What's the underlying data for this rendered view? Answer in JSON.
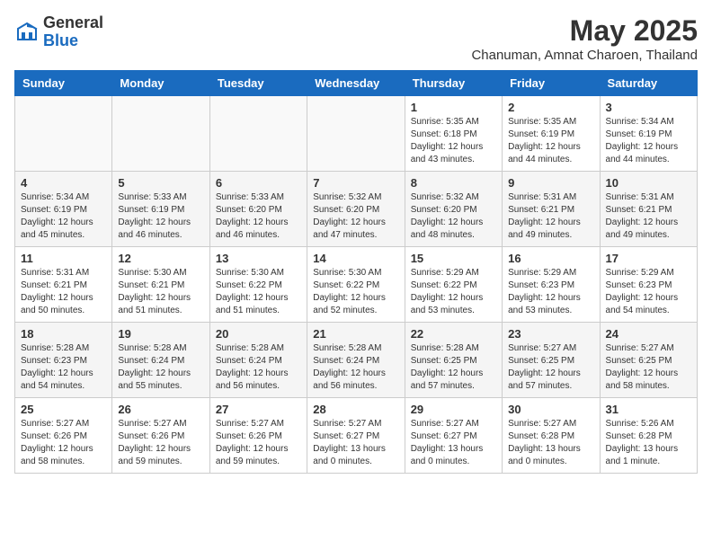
{
  "logo": {
    "general": "General",
    "blue": "Blue"
  },
  "title": "May 2025",
  "location": "Chanuman, Amnat Charoen, Thailand",
  "days_of_week": [
    "Sunday",
    "Monday",
    "Tuesday",
    "Wednesday",
    "Thursday",
    "Friday",
    "Saturday"
  ],
  "weeks": [
    [
      {
        "day": "",
        "sunrise": "",
        "sunset": "",
        "daylight": "",
        "empty": true
      },
      {
        "day": "",
        "sunrise": "",
        "sunset": "",
        "daylight": "",
        "empty": true
      },
      {
        "day": "",
        "sunrise": "",
        "sunset": "",
        "daylight": "",
        "empty": true
      },
      {
        "day": "",
        "sunrise": "",
        "sunset": "",
        "daylight": "",
        "empty": true
      },
      {
        "day": "1",
        "sunrise": "Sunrise: 5:35 AM",
        "sunset": "Sunset: 6:18 PM",
        "daylight": "Daylight: 12 hours and 43 minutes.",
        "empty": false
      },
      {
        "day": "2",
        "sunrise": "Sunrise: 5:35 AM",
        "sunset": "Sunset: 6:19 PM",
        "daylight": "Daylight: 12 hours and 44 minutes.",
        "empty": false
      },
      {
        "day": "3",
        "sunrise": "Sunrise: 5:34 AM",
        "sunset": "Sunset: 6:19 PM",
        "daylight": "Daylight: 12 hours and 44 minutes.",
        "empty": false
      }
    ],
    [
      {
        "day": "4",
        "sunrise": "Sunrise: 5:34 AM",
        "sunset": "Sunset: 6:19 PM",
        "daylight": "Daylight: 12 hours and 45 minutes.",
        "empty": false
      },
      {
        "day": "5",
        "sunrise": "Sunrise: 5:33 AM",
        "sunset": "Sunset: 6:19 PM",
        "daylight": "Daylight: 12 hours and 46 minutes.",
        "empty": false
      },
      {
        "day": "6",
        "sunrise": "Sunrise: 5:33 AM",
        "sunset": "Sunset: 6:20 PM",
        "daylight": "Daylight: 12 hours and 46 minutes.",
        "empty": false
      },
      {
        "day": "7",
        "sunrise": "Sunrise: 5:32 AM",
        "sunset": "Sunset: 6:20 PM",
        "daylight": "Daylight: 12 hours and 47 minutes.",
        "empty": false
      },
      {
        "day": "8",
        "sunrise": "Sunrise: 5:32 AM",
        "sunset": "Sunset: 6:20 PM",
        "daylight": "Daylight: 12 hours and 48 minutes.",
        "empty": false
      },
      {
        "day": "9",
        "sunrise": "Sunrise: 5:31 AM",
        "sunset": "Sunset: 6:21 PM",
        "daylight": "Daylight: 12 hours and 49 minutes.",
        "empty": false
      },
      {
        "day": "10",
        "sunrise": "Sunrise: 5:31 AM",
        "sunset": "Sunset: 6:21 PM",
        "daylight": "Daylight: 12 hours and 49 minutes.",
        "empty": false
      }
    ],
    [
      {
        "day": "11",
        "sunrise": "Sunrise: 5:31 AM",
        "sunset": "Sunset: 6:21 PM",
        "daylight": "Daylight: 12 hours and 50 minutes.",
        "empty": false
      },
      {
        "day": "12",
        "sunrise": "Sunrise: 5:30 AM",
        "sunset": "Sunset: 6:21 PM",
        "daylight": "Daylight: 12 hours and 51 minutes.",
        "empty": false
      },
      {
        "day": "13",
        "sunrise": "Sunrise: 5:30 AM",
        "sunset": "Sunset: 6:22 PM",
        "daylight": "Daylight: 12 hours and 51 minutes.",
        "empty": false
      },
      {
        "day": "14",
        "sunrise": "Sunrise: 5:30 AM",
        "sunset": "Sunset: 6:22 PM",
        "daylight": "Daylight: 12 hours and 52 minutes.",
        "empty": false
      },
      {
        "day": "15",
        "sunrise": "Sunrise: 5:29 AM",
        "sunset": "Sunset: 6:22 PM",
        "daylight": "Daylight: 12 hours and 53 minutes.",
        "empty": false
      },
      {
        "day": "16",
        "sunrise": "Sunrise: 5:29 AM",
        "sunset": "Sunset: 6:23 PM",
        "daylight": "Daylight: 12 hours and 53 minutes.",
        "empty": false
      },
      {
        "day": "17",
        "sunrise": "Sunrise: 5:29 AM",
        "sunset": "Sunset: 6:23 PM",
        "daylight": "Daylight: 12 hours and 54 minutes.",
        "empty": false
      }
    ],
    [
      {
        "day": "18",
        "sunrise": "Sunrise: 5:28 AM",
        "sunset": "Sunset: 6:23 PM",
        "daylight": "Daylight: 12 hours and 54 minutes.",
        "empty": false
      },
      {
        "day": "19",
        "sunrise": "Sunrise: 5:28 AM",
        "sunset": "Sunset: 6:24 PM",
        "daylight": "Daylight: 12 hours and 55 minutes.",
        "empty": false
      },
      {
        "day": "20",
        "sunrise": "Sunrise: 5:28 AM",
        "sunset": "Sunset: 6:24 PM",
        "daylight": "Daylight: 12 hours and 56 minutes.",
        "empty": false
      },
      {
        "day": "21",
        "sunrise": "Sunrise: 5:28 AM",
        "sunset": "Sunset: 6:24 PM",
        "daylight": "Daylight: 12 hours and 56 minutes.",
        "empty": false
      },
      {
        "day": "22",
        "sunrise": "Sunrise: 5:28 AM",
        "sunset": "Sunset: 6:25 PM",
        "daylight": "Daylight: 12 hours and 57 minutes.",
        "empty": false
      },
      {
        "day": "23",
        "sunrise": "Sunrise: 5:27 AM",
        "sunset": "Sunset: 6:25 PM",
        "daylight": "Daylight: 12 hours and 57 minutes.",
        "empty": false
      },
      {
        "day": "24",
        "sunrise": "Sunrise: 5:27 AM",
        "sunset": "Sunset: 6:25 PM",
        "daylight": "Daylight: 12 hours and 58 minutes.",
        "empty": false
      }
    ],
    [
      {
        "day": "25",
        "sunrise": "Sunrise: 5:27 AM",
        "sunset": "Sunset: 6:26 PM",
        "daylight": "Daylight: 12 hours and 58 minutes.",
        "empty": false
      },
      {
        "day": "26",
        "sunrise": "Sunrise: 5:27 AM",
        "sunset": "Sunset: 6:26 PM",
        "daylight": "Daylight: 12 hours and 59 minutes.",
        "empty": false
      },
      {
        "day": "27",
        "sunrise": "Sunrise: 5:27 AM",
        "sunset": "Sunset: 6:26 PM",
        "daylight": "Daylight: 12 hours and 59 minutes.",
        "empty": false
      },
      {
        "day": "28",
        "sunrise": "Sunrise: 5:27 AM",
        "sunset": "Sunset: 6:27 PM",
        "daylight": "Daylight: 13 hours and 0 minutes.",
        "empty": false
      },
      {
        "day": "29",
        "sunrise": "Sunrise: 5:27 AM",
        "sunset": "Sunset: 6:27 PM",
        "daylight": "Daylight: 13 hours and 0 minutes.",
        "empty": false
      },
      {
        "day": "30",
        "sunrise": "Sunrise: 5:27 AM",
        "sunset": "Sunset: 6:28 PM",
        "daylight": "Daylight: 13 hours and 0 minutes.",
        "empty": false
      },
      {
        "day": "31",
        "sunrise": "Sunrise: 5:26 AM",
        "sunset": "Sunset: 6:28 PM",
        "daylight": "Daylight: 13 hours and 1 minute.",
        "empty": false
      }
    ]
  ]
}
